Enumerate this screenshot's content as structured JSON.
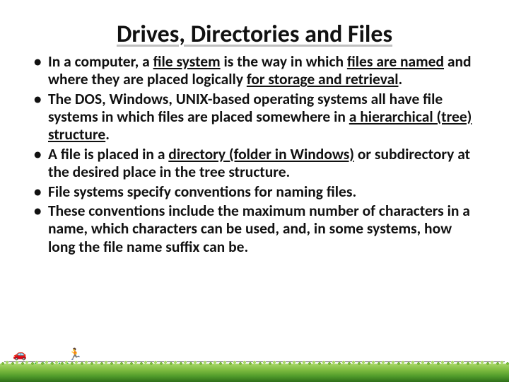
{
  "title": "Drives, Directories and Files",
  "bullets": [
    {
      "pre": "In a computer, a ",
      "u1": "file system",
      "mid1": " is the way in which ",
      "u2": "files are named",
      "mid2": " and where they are placed logically ",
      "u3": "for storage and retrieval",
      "post": "."
    },
    {
      "pre": "The DOS, Windows, UNIX-based operating systems all have file systems in which files are placed somewhere in ",
      "u1": "a hierarchical (tree) structure",
      "post": "."
    },
    {
      "pre": "A file is placed in a ",
      "u1": "directory (folder in Windows)",
      "post": " or subdirectory at the desired place in the tree structure."
    },
    {
      "text": "File systems specify conventions for naming files."
    },
    {
      "text": "These conventions include the maximum number of characters in a name, which characters can be used, and, in some systems, how long the file name suffix can be."
    }
  ]
}
